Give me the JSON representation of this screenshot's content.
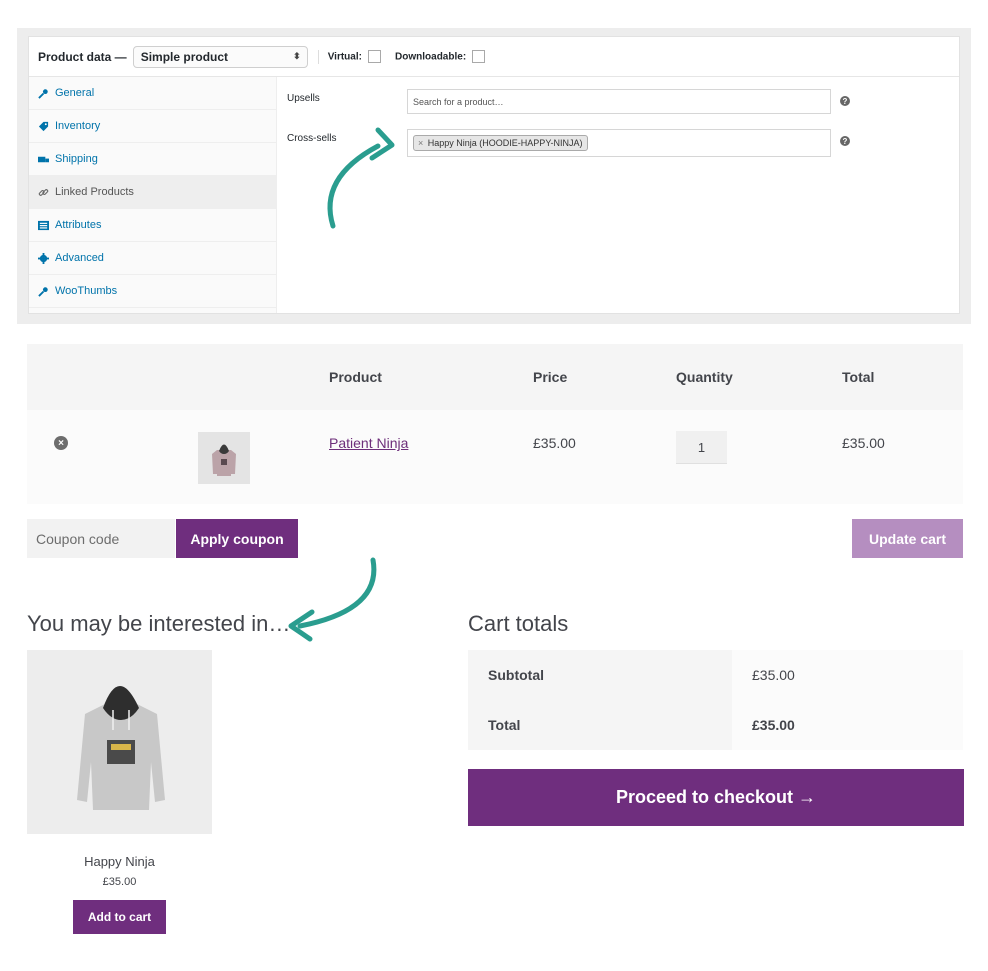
{
  "admin": {
    "product_data_label": "Product data —",
    "product_type": "Simple product",
    "virtual_label": "Virtual:",
    "downloadable_label": "Downloadable:",
    "tabs": [
      {
        "label": "General",
        "icon": "wrench-icon"
      },
      {
        "label": "Inventory",
        "icon": "tag-icon"
      },
      {
        "label": "Shipping",
        "icon": "truck-icon"
      },
      {
        "label": "Linked Products",
        "icon": "link-icon",
        "active": true
      },
      {
        "label": "Attributes",
        "icon": "list-icon"
      },
      {
        "label": "Advanced",
        "icon": "gear-icon"
      },
      {
        "label": "WooThumbs",
        "icon": "wrench-icon"
      }
    ],
    "upsells_label": "Upsells",
    "upsells_placeholder": "Search for a product…",
    "crosssells_label": "Cross-sells",
    "crosssells_chip": "Happy Ninja (HOODIE-HAPPY-NINJA)",
    "chip_remove": "×",
    "help": "?"
  },
  "cart": {
    "headers": {
      "product": "Product",
      "price": "Price",
      "quantity": "Quantity",
      "total": "Total"
    },
    "row": {
      "name": "Patient Ninja",
      "price": "£35.00",
      "quantity": "1",
      "total": "£35.00"
    },
    "remove_symbol": "×",
    "coupon_placeholder": "Coupon code",
    "apply_coupon": "Apply coupon",
    "update_cart": "Update cart"
  },
  "cross_sells": {
    "title": "You may be interested in…",
    "product_name": "Happy Ninja",
    "product_price": "£35.00",
    "add_to_cart": "Add to cart"
  },
  "totals": {
    "title": "Cart totals",
    "subtotal_label": "Subtotal",
    "subtotal_value": "£35.00",
    "total_label": "Total",
    "total_value": "£35.00",
    "checkout": "Proceed to checkout →"
  },
  "colors": {
    "brand_purple": "#6f2e7e",
    "update_purple_light": "#b58ec0",
    "arrow_teal": "#2a9d8f",
    "link_blue": "#0073aa"
  }
}
